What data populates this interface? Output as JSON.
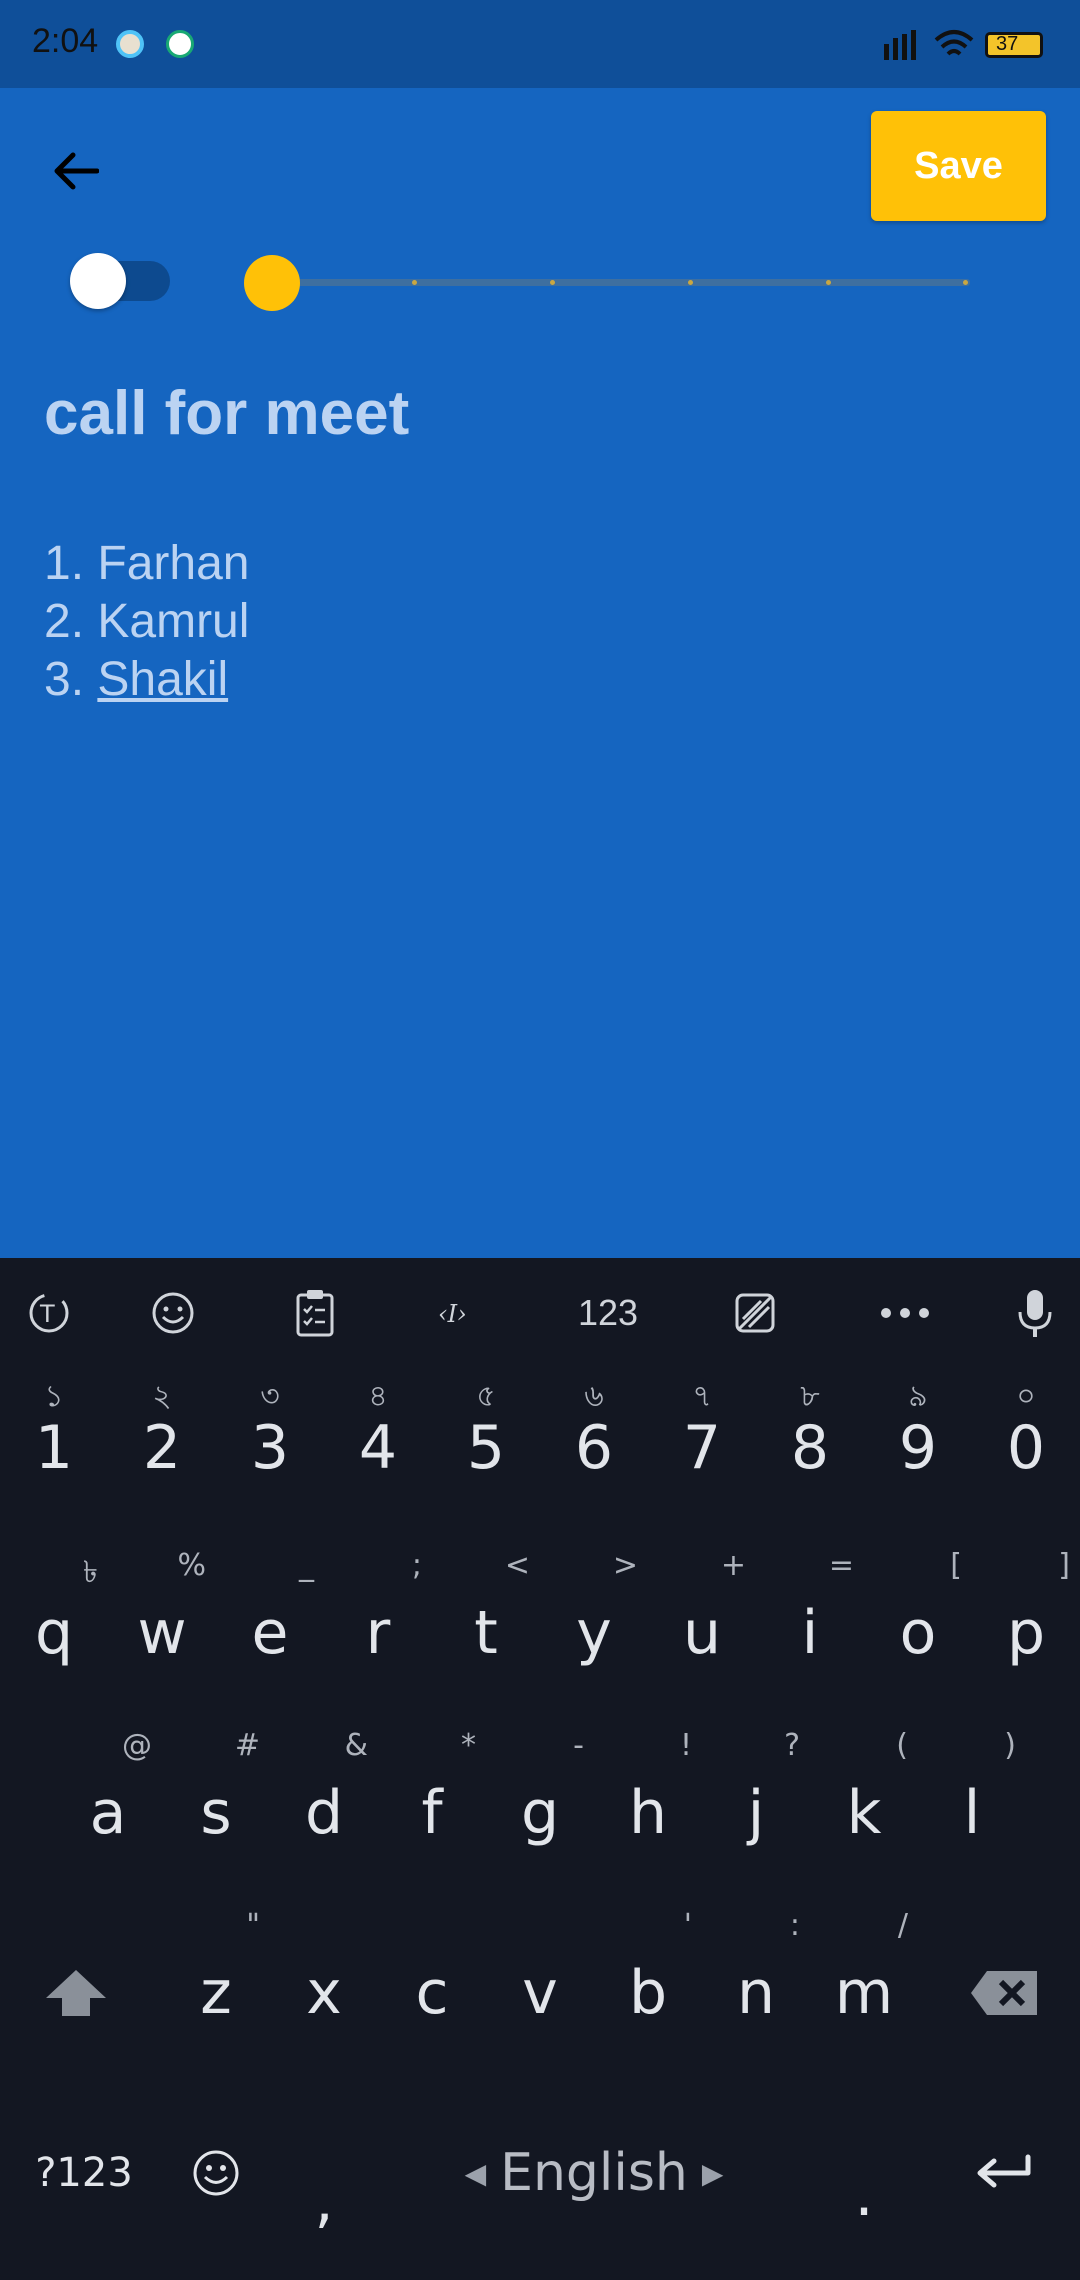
{
  "status_bar": {
    "time": "2:04",
    "battery": "37"
  },
  "toolbar": {
    "save_label": "Save"
  },
  "note": {
    "title": "call for meet",
    "lines": [
      "1. Farhan",
      "2. Kamrul",
      "3. "
    ],
    "underlined_word": "Shakil"
  },
  "editor_controls": {
    "toggle_on": false,
    "slider_level": 0,
    "slider_steps": 5
  },
  "keyboard": {
    "toolbar": {
      "numbers_label": "123"
    },
    "number_row": [
      {
        "main": "1",
        "sec": "১"
      },
      {
        "main": "2",
        "sec": "২"
      },
      {
        "main": "3",
        "sec": "৩"
      },
      {
        "main": "4",
        "sec": "৪"
      },
      {
        "main": "5",
        "sec": "৫"
      },
      {
        "main": "6",
        "sec": "৬"
      },
      {
        "main": "7",
        "sec": "৭"
      },
      {
        "main": "8",
        "sec": "৮"
      },
      {
        "main": "9",
        "sec": "৯"
      },
      {
        "main": "0",
        "sec": "০"
      }
    ],
    "row_1": [
      {
        "main": "q",
        "sec": "৳"
      },
      {
        "main": "w",
        "sec": "%"
      },
      {
        "main": "e",
        "sec": "_"
      },
      {
        "main": "r",
        "sec": ";"
      },
      {
        "main": "t",
        "sec": "<"
      },
      {
        "main": "y",
        "sec": ">"
      },
      {
        "main": "u",
        "sec": "+"
      },
      {
        "main": "i",
        "sec": "="
      },
      {
        "main": "o",
        "sec": "["
      },
      {
        "main": "p",
        "sec": "]"
      }
    ],
    "row_2": [
      {
        "main": "a",
        "sec": "@"
      },
      {
        "main": "s",
        "sec": "#"
      },
      {
        "main": "d",
        "sec": "&"
      },
      {
        "main": "f",
        "sec": "*"
      },
      {
        "main": "g",
        "sec": "-"
      },
      {
        "main": "h",
        "sec": "!"
      },
      {
        "main": "j",
        "sec": "?"
      },
      {
        "main": "k",
        "sec": "("
      },
      {
        "main": "l",
        "sec": ")"
      }
    ],
    "row_3": [
      {
        "main": "z",
        "sec": "\""
      },
      {
        "main": "x",
        "sec": ""
      },
      {
        "main": "c",
        "sec": ""
      },
      {
        "main": "v",
        "sec": ""
      },
      {
        "main": "b",
        "sec": "'"
      },
      {
        "main": "n",
        "sec": ":"
      },
      {
        "main": "m",
        "sec": "/"
      }
    ],
    "bottom": {
      "symbols_label": "?123",
      "comma": ",",
      "space_label": "English",
      "period": "."
    }
  },
  "colors": {
    "app_background": "#1565C0",
    "accent": "#FFC107",
    "keyboard_background": "#131722"
  }
}
